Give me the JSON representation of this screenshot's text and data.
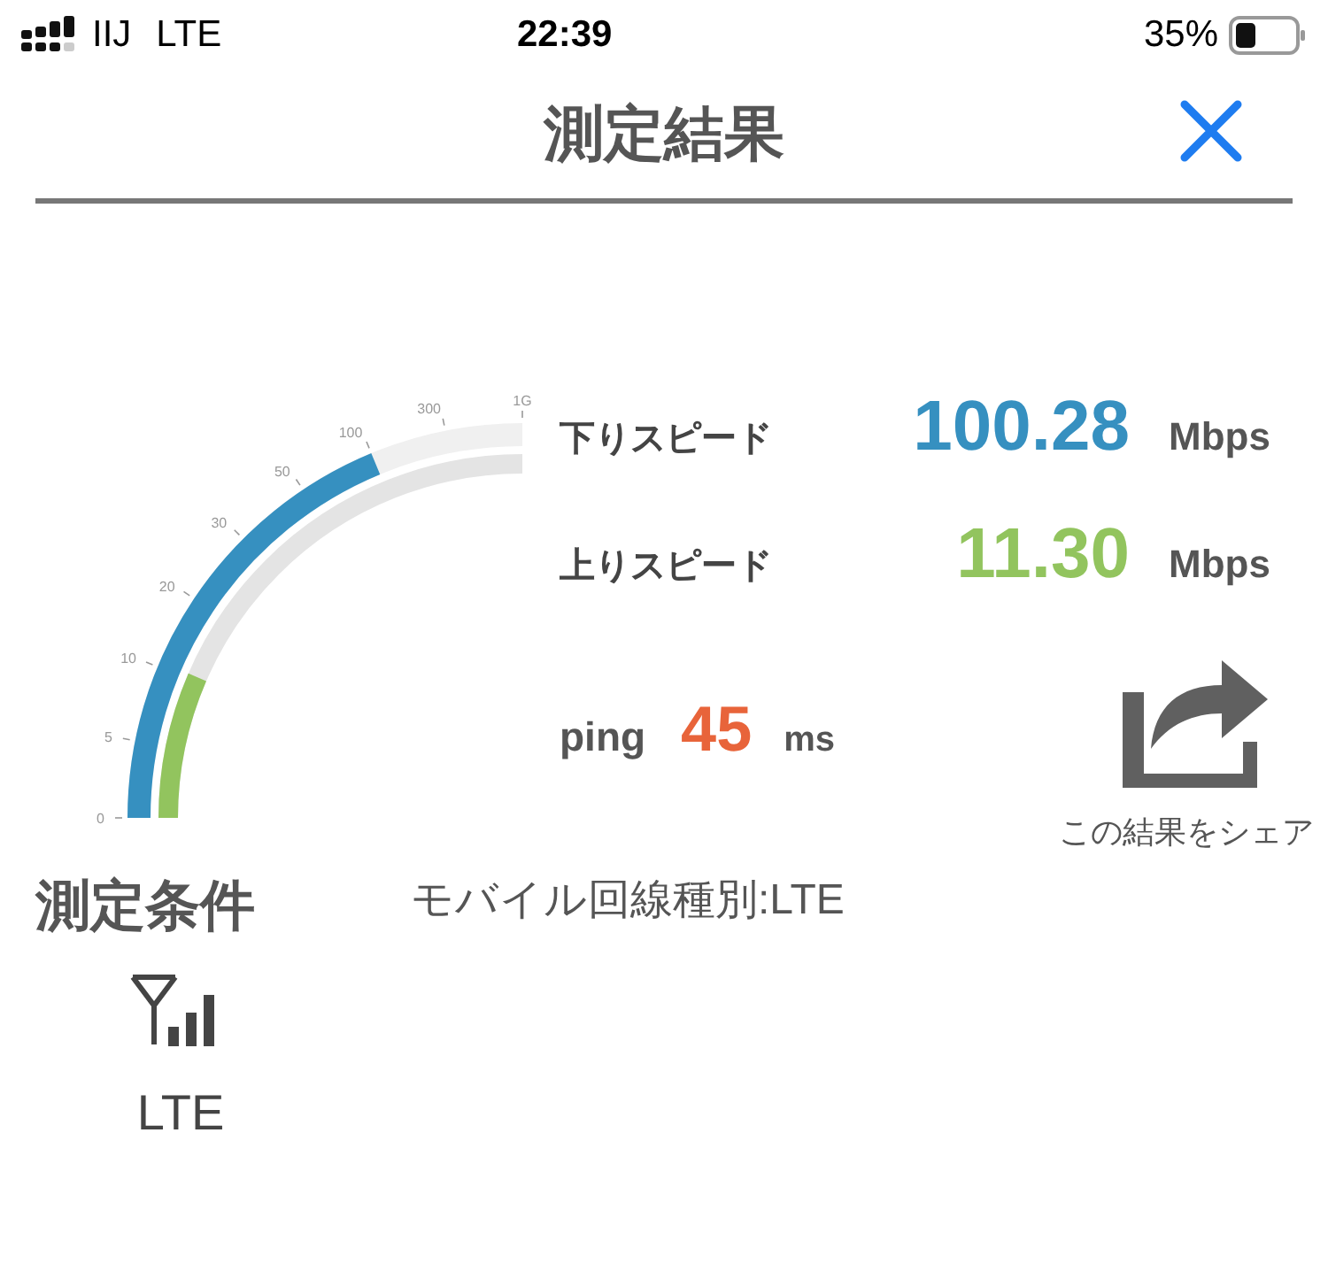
{
  "status_bar": {
    "carrier": "IIJ",
    "network": "LTE",
    "time": "22:39",
    "battery": "35%"
  },
  "header": {
    "title": "測定結果"
  },
  "gauge": {
    "ticks": [
      "0",
      "5",
      "10",
      "20",
      "30",
      "50",
      "100",
      "300",
      "1G"
    ]
  },
  "results": [
    {
      "kind": "download",
      "label": "下りスピード",
      "value": "100.28",
      "unit": "Mbps"
    },
    {
      "kind": "upload",
      "label": "上りスピード",
      "value": "11.30",
      "unit": "Mbps"
    },
    {
      "kind": "ping",
      "label": "ping",
      "value": "45",
      "unit": "ms"
    }
  ],
  "share": {
    "label": "この結果をシェア"
  },
  "conditions": {
    "title": "測定条件",
    "detail": "モバイル回線種別:LTE",
    "network_label": "LTE"
  }
}
